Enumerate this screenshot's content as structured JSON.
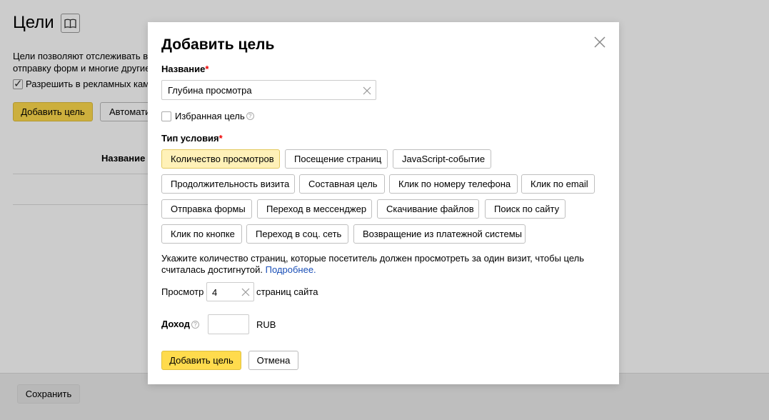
{
  "background": {
    "title": "Цели",
    "description_line1": "Цели позволяют отслеживать ва",
    "description_line2": "отправку форм и многие другие",
    "checkbox_label": "Разрешить в рекламных камп",
    "add_goal_button": "Добавить цель",
    "auto_button": "Автомати",
    "column_header": "Название ц",
    "save_button": "Сохранить"
  },
  "modal": {
    "title": "Добавить цель",
    "name_label": "Название",
    "required_mark": "*",
    "name_value": "Глубина просмотра",
    "favorite_label": "Избранная цель",
    "favorite_checked": false,
    "condition_type_label": "Тип условия",
    "condition_types": [
      {
        "label": "Количество просмотров",
        "active": true
      },
      {
        "label": "Посещение страниц",
        "active": false
      },
      {
        "label": "JavaScript-событие",
        "active": false
      },
      {
        "label": "Продолжительность визита",
        "active": false
      },
      {
        "label": "Составная цель",
        "active": false
      },
      {
        "label": "Клик по номеру телефона",
        "active": false
      },
      {
        "label": "Клик по email",
        "active": false
      },
      {
        "label": "Отправка формы",
        "active": false
      },
      {
        "label": "Переход в мессенджер",
        "active": false
      },
      {
        "label": "Скачивание файлов",
        "active": false
      },
      {
        "label": "Поиск по сайту",
        "active": false
      },
      {
        "label": "Клик по кнопке",
        "active": false
      },
      {
        "label": "Переход в соц. сеть",
        "active": false
      },
      {
        "label": "Возвращение из платежной системы",
        "active": false
      }
    ],
    "hint_text_line1": "Укажите количество страниц, которые посетитель должен просмотреть за один визит, чтобы цель",
    "hint_text_line2": "считалась достигнутой.",
    "hint_link": "Подробнее.",
    "views_label": "Просмотр",
    "views_value": "4",
    "views_suffix": "страниц сайта",
    "income_label": "Доход",
    "income_value": "",
    "currency": "RUB",
    "submit_button": "Добавить цель",
    "cancel_button": "Отмена"
  },
  "colors": {
    "accent_yellow": "#ffdb4d",
    "active_chip": "#fff1b8",
    "required": "#e00000",
    "link": "#1a4fb7"
  }
}
